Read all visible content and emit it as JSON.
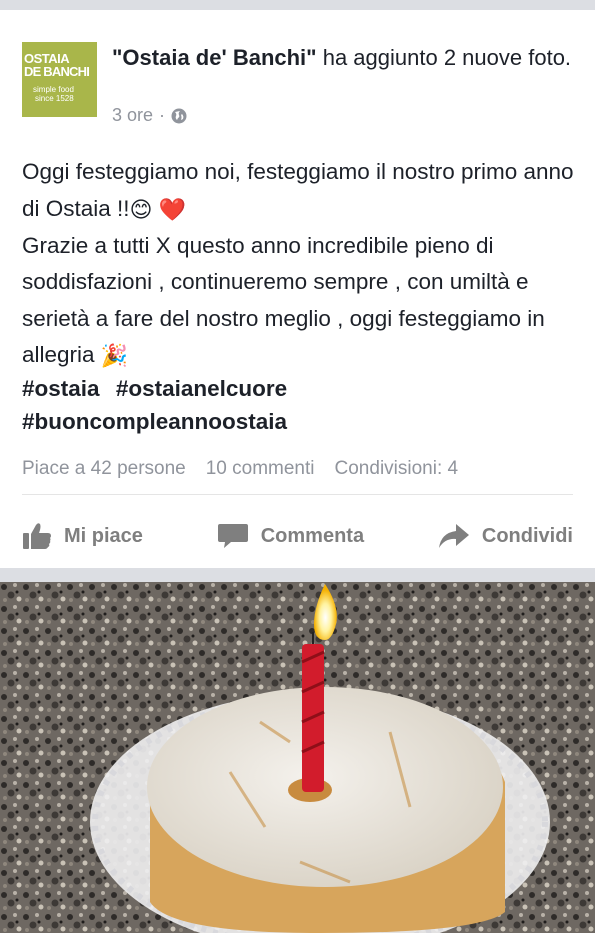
{
  "post": {
    "page_logo": {
      "line1": "OSTAIA",
      "line2": "DE BANCHI",
      "line3": "simple food",
      "line4": "since 1528",
      "color": "#a9b64a"
    },
    "author": "\"Ostaia de' Banchi\"",
    "action": " ha aggiunto 2 nuove foto.",
    "time": "3 ore",
    "separator": "·",
    "privacy_icon": "globe-icon",
    "text_lines": [
      "Oggi festeggiamo noi, festeggiamo il nostro primo anno di Ostaia !!",
      "Grazie a tutti X questo anno incredibile pieno di soddisfazioni , continueremo sempre , con umiltà e serietà a fare del nostro meglio , oggi festeggiamo in allegria"
    ],
    "emojis": {
      "smile": "😊",
      "heart": "❤️",
      "party": "🎉"
    },
    "hashtags": [
      "#ostaia",
      "#ostaianelcuore",
      "#buoncompleannoostaia"
    ],
    "stats": {
      "likes": "Piace a 42 persone",
      "comments": "10 commenti",
      "shares": "Condivisioni: 4"
    },
    "actions": {
      "like": "Mi piace",
      "comment": "Commenta",
      "share": "Condividi"
    }
  },
  "colors": {
    "text": "#1d2129",
    "secondary": "#90949c",
    "action": "#7f7f7f",
    "background": "#dcdee3"
  }
}
